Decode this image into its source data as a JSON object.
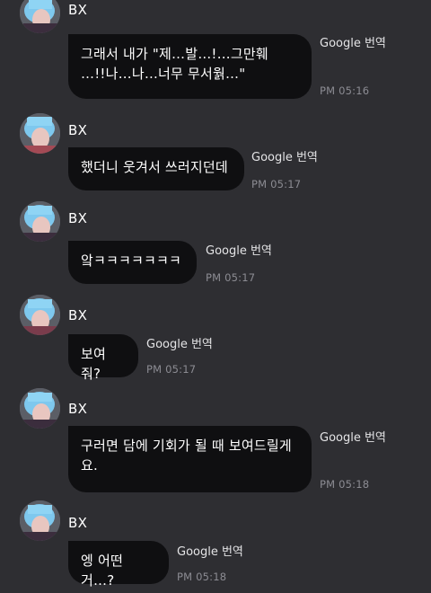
{
  "colors": {
    "background": "#2e2e32",
    "bubble": "#0f0f11",
    "text": "#ffffff",
    "timestamp": "#8c8c93",
    "avatar_hair": "#7ec8ee"
  },
  "messages": [
    {
      "sender": "BX",
      "avatar_icon": "profile-avatar",
      "text": "그래서 내가 \"제…발…!…그만훼\n…!!나…나…너무 무서웕…\"",
      "translate_label": "Google 번역",
      "time": "PM 05:16"
    },
    {
      "sender": "BX",
      "avatar_icon": "profile-avatar",
      "text": "했더니 웃겨서 쓰러지던데",
      "translate_label": "Google 번역",
      "time": "PM 05:17"
    },
    {
      "sender": "BX",
      "avatar_icon": "profile-avatar",
      "text": "앜ㅋㅋㅋㅋㅋㅋㅋ",
      "translate_label": "Google 번역",
      "time": "PM 05:17"
    },
    {
      "sender": "BX",
      "avatar_icon": "profile-avatar",
      "text": "보여줘?",
      "translate_label": "Google 번역",
      "time": "PM 05:17"
    },
    {
      "sender": "BX",
      "avatar_icon": "profile-avatar",
      "text": "구러면 담에 기회가 될 때 보여드릴게\n요.",
      "translate_label": "Google 번역",
      "time": "PM 05:18"
    },
    {
      "sender": "BX",
      "avatar_icon": "profile-avatar",
      "text": "엥 어떤거…?",
      "translate_label": "Google 번역",
      "time": "PM 05:18"
    }
  ]
}
